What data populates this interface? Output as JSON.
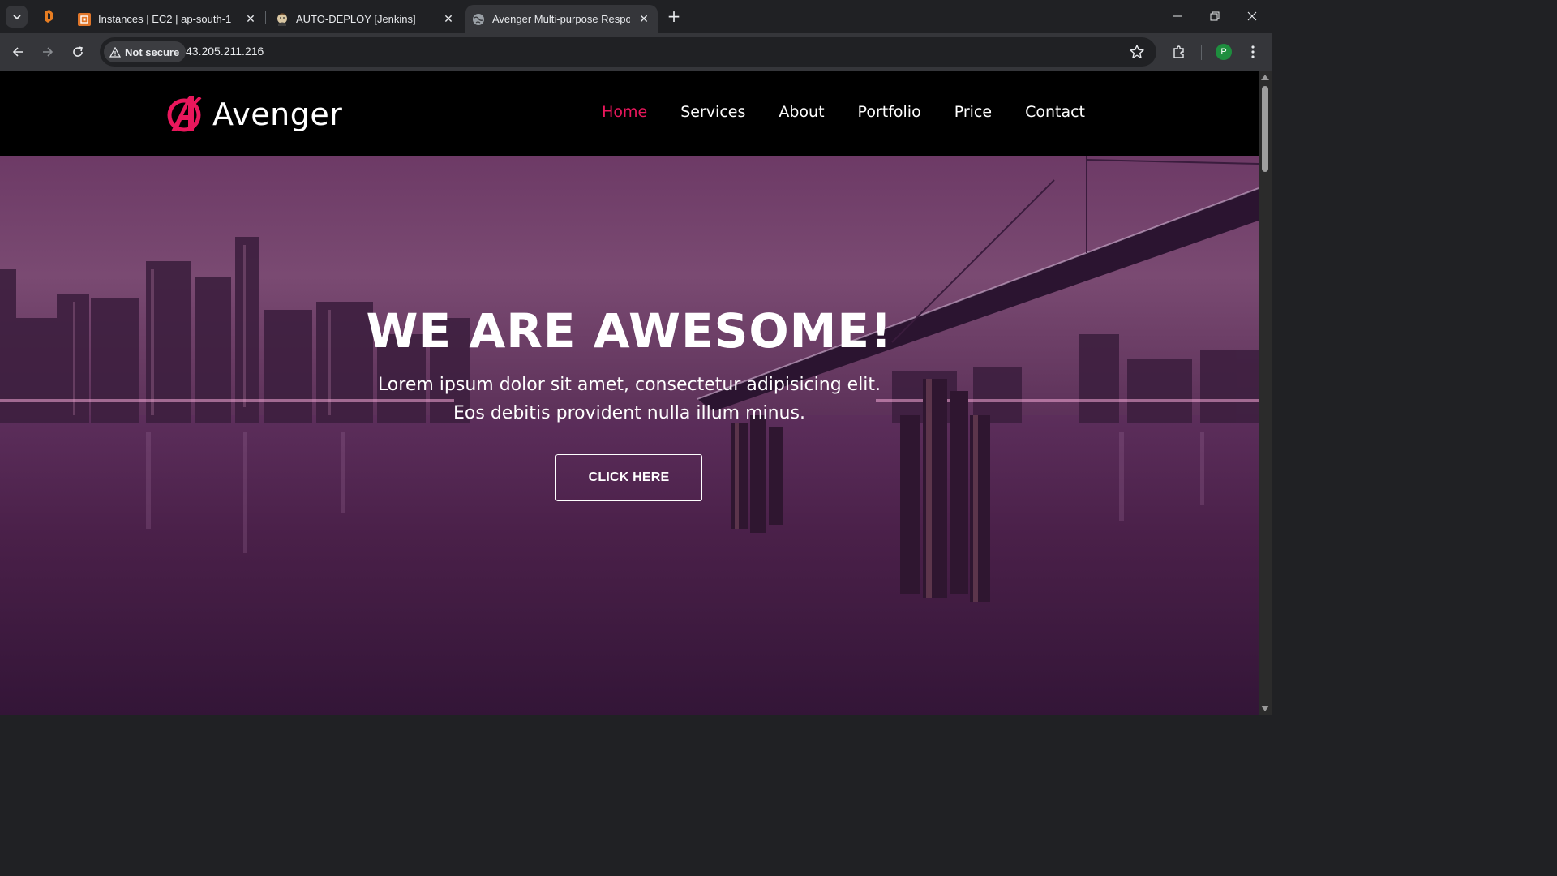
{
  "browser": {
    "tabs": [
      {
        "title": "Instances | EC2 | ap-south-1",
        "icon": "aws-ec2-icon"
      },
      {
        "title": "AUTO-DEPLOY [Jenkins]",
        "icon": "jenkins-icon"
      },
      {
        "title": "Avenger Multi-purpose Respon",
        "icon": "globe-icon"
      }
    ],
    "security_chip": "Not secure",
    "url": "43.205.211.216",
    "profile_initial": "P"
  },
  "site": {
    "brand": "Avenger",
    "nav": [
      "Home",
      "Services",
      "About",
      "Portfolio",
      "Price",
      "Contact"
    ],
    "active_nav": "Home",
    "hero": {
      "title": "WE ARE AWESOME!",
      "subtitle_line1": "Lorem ipsum dolor sit amet, consectetur adipisicing elit.",
      "subtitle_line2": "Eos debitis provident nulla illum minus.",
      "button": "CLICK HERE"
    }
  },
  "colors": {
    "accent": "#e9175c",
    "header_bg": "#000000",
    "hero_tint": "#4e2350"
  }
}
